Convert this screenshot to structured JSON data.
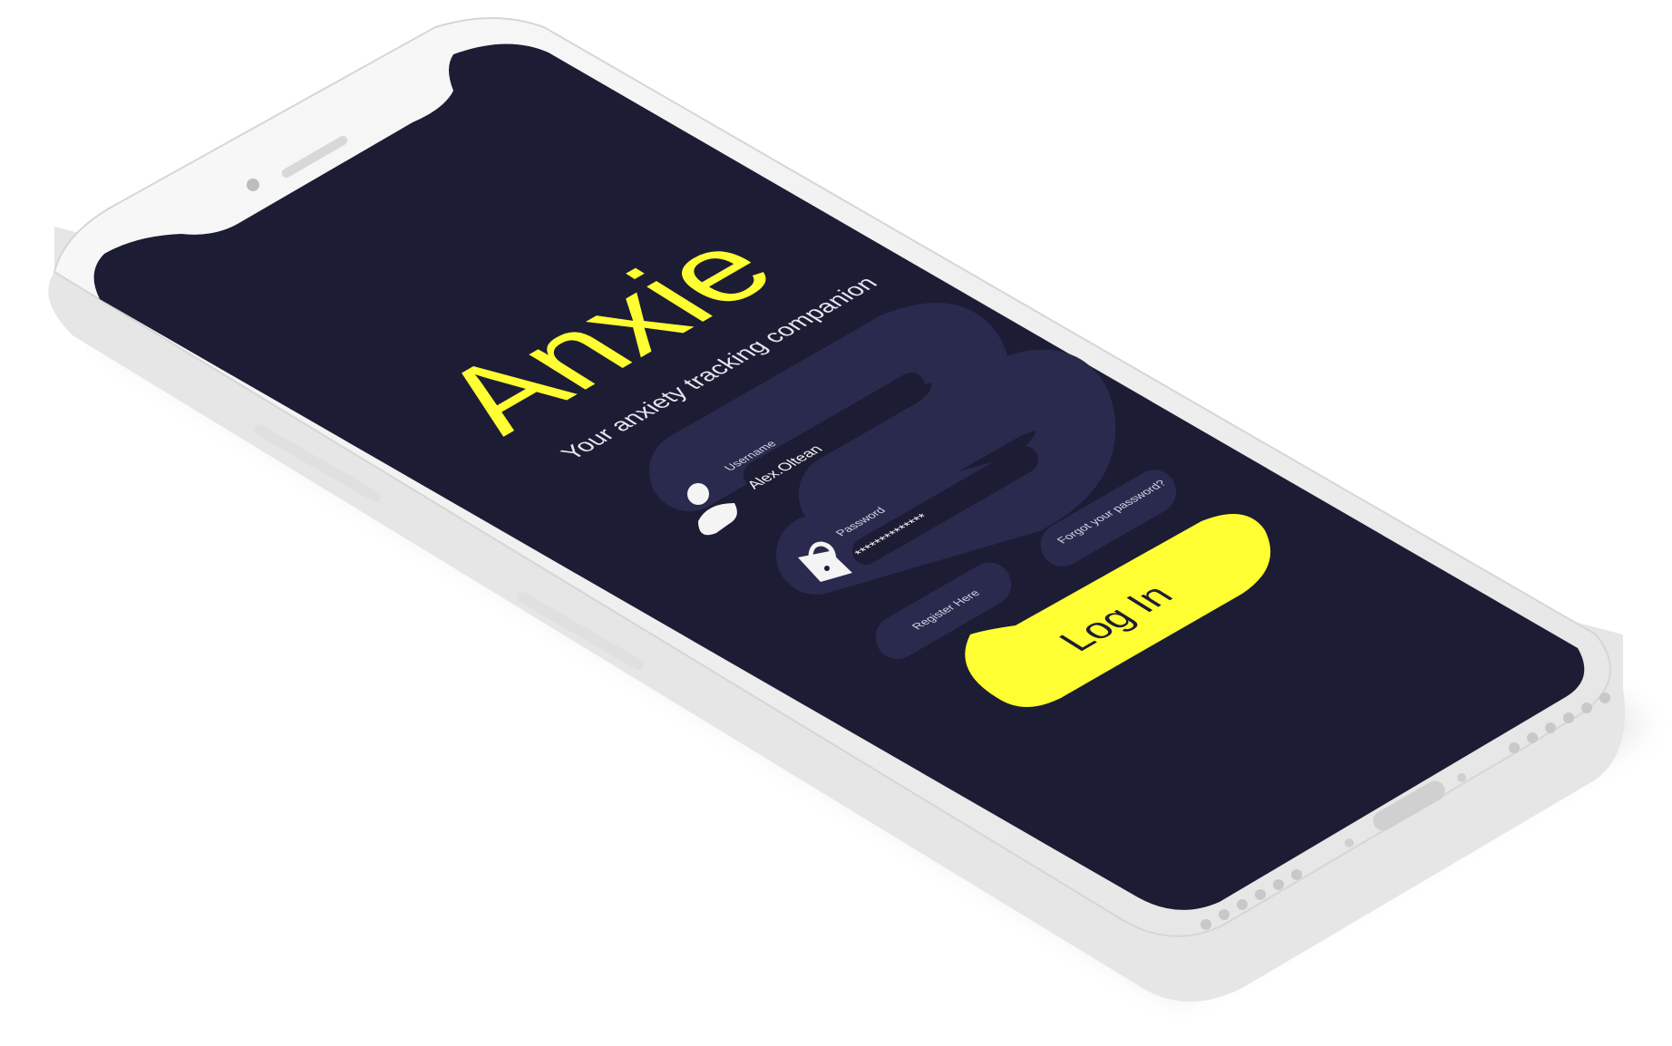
{
  "app": {
    "name": "Anxie",
    "tagline": "Your anxiety tracking companion"
  },
  "login_form": {
    "username_label": "Username",
    "username_value": "Alex.Oltean",
    "password_label": "Password",
    "password_value": "**************",
    "forgot_label": "Forgot your password?",
    "register_label": "Register Here",
    "login_label": "Log In"
  },
  "icons": {
    "username": "user-icon",
    "password": "lock-icon"
  },
  "colors": {
    "screen_background": "#1c1c34",
    "accent_yellow": "#fefe33",
    "track": "#2a2a4e",
    "field": "#1c1c34",
    "text_light": "#e6e6f0",
    "button_text": "#1c1c34",
    "phone_body": "#f2f2f2"
  }
}
